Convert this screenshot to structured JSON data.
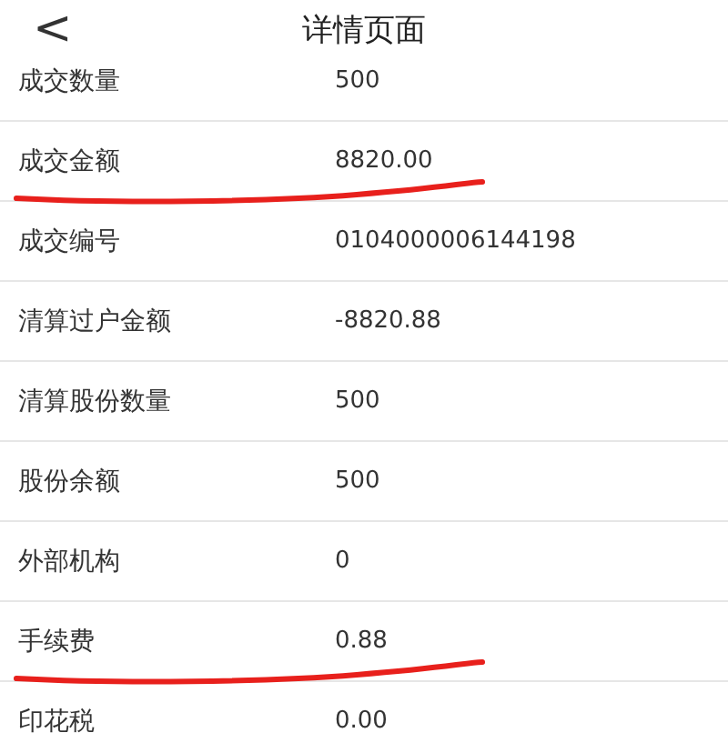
{
  "header": {
    "back": "<",
    "title": "详情页面"
  },
  "rows": [
    {
      "label": "成交数量",
      "value": "500",
      "underlined": false
    },
    {
      "label": "成交金额",
      "value": "8820.00",
      "underlined": true
    },
    {
      "label": "成交编号",
      "value": "0104000006144198",
      "underlined": false
    },
    {
      "label": "清算过户金额",
      "value": "-8820.88",
      "underlined": false
    },
    {
      "label": "清算股份数量",
      "value": "500",
      "underlined": false
    },
    {
      "label": "股份余额",
      "value": "500",
      "underlined": false
    },
    {
      "label": "外部机构",
      "value": "0",
      "underlined": false
    },
    {
      "label": "手续费",
      "value": "0.88",
      "underlined": true
    },
    {
      "label": "印花税",
      "value": "0.00",
      "underlined": false
    }
  ]
}
